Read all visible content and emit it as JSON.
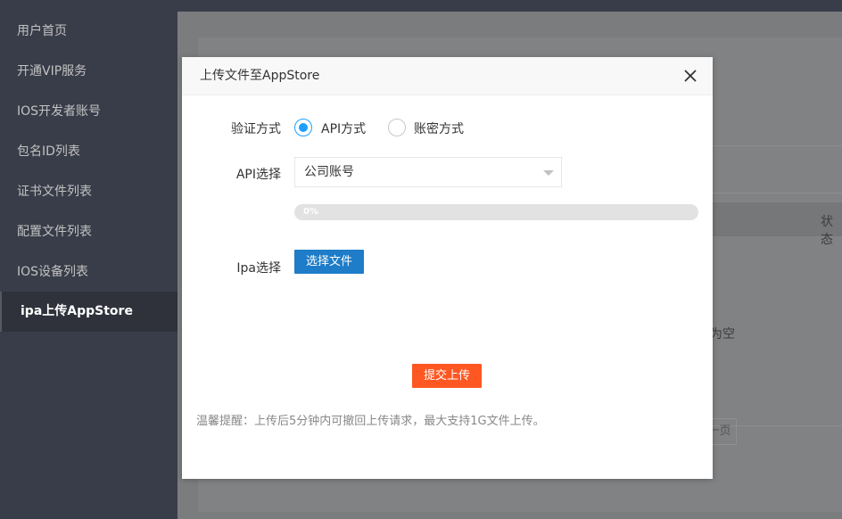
{
  "sidebar": {
    "items": [
      {
        "label": "用户首页",
        "active": false
      },
      {
        "label": "开通VIP服务",
        "active": false
      },
      {
        "label": "IOS开发者账号",
        "active": false
      },
      {
        "label": "包名ID列表",
        "active": false
      },
      {
        "label": "证书文件列表",
        "active": false
      },
      {
        "label": "配置文件列表",
        "active": false
      },
      {
        "label": "IOS设备列表",
        "active": false
      },
      {
        "label": "ipa上传AppStore",
        "active": true
      }
    ]
  },
  "background": {
    "column_status": "状态",
    "empty_text": "为空",
    "next_page": "下一页"
  },
  "modal": {
    "title": "上传文件至AppStore",
    "close_icon": "close-icon",
    "verify": {
      "label": "验证方式",
      "options": [
        {
          "label": "API方式",
          "checked": true
        },
        {
          "label": "账密方式",
          "checked": false
        }
      ]
    },
    "api_select": {
      "label": "API选择",
      "value": "公司账号"
    },
    "progress": {
      "text": "0%",
      "percent": 0
    },
    "ipa": {
      "label": "Ipa选择",
      "button": "选择文件"
    },
    "submit": "提交上传",
    "tip": "温馨提醒：上传后5分钟内可撤回上传请求，最大支持1G文件上传。"
  },
  "colors": {
    "accent": "#1e9fff",
    "button_blue": "#1e7cc8",
    "button_orange": "#ff5722"
  }
}
